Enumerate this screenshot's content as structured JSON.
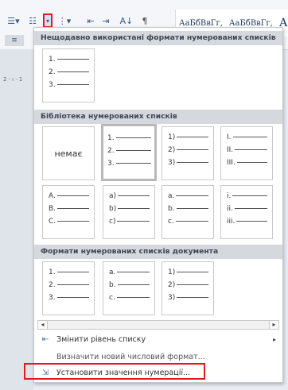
{
  "ribbon": {
    "bullets_icon": "bullet-list-icon",
    "numbering_icon": "numbered-list-icon",
    "multilevel_icon": "multilevel-list-icon",
    "decrease_indent_icon": "decrease-indent-icon",
    "increase_indent_icon": "increase-indent-icon",
    "sort_label": "A↓",
    "pilcrow_label": "¶",
    "styles": [
      "АаБбВвГг,",
      "АаБбВвГг,",
      "А"
    ],
    "ruler_text": "2 · ı · 1"
  },
  "gallery": {
    "recent": {
      "title": "Нещодавно використані формати нумерованих списків",
      "tiles": [
        [
          "1.",
          "2.",
          "3."
        ]
      ]
    },
    "library": {
      "title": "Бібліотека нумерованих списків",
      "none_label": "немає",
      "tiles": [
        [
          "1.",
          "2.",
          "3."
        ],
        [
          "1)",
          "2)",
          "3)"
        ],
        [
          "I.",
          "II.",
          "III."
        ],
        [
          "A.",
          "B.",
          "C."
        ],
        [
          "a)",
          "b)",
          "c)"
        ],
        [
          "a.",
          "b.",
          "c."
        ],
        [
          "i.",
          "ii.",
          "iii."
        ]
      ]
    },
    "document": {
      "title": "Формати нумерованих списків документа",
      "tiles": [
        [
          "1.",
          "2.",
          "3."
        ],
        [
          "a.",
          "b.",
          "c."
        ],
        [
          "1)",
          "2)",
          "3)"
        ]
      ]
    }
  },
  "menu": {
    "change_level": "Змінити рівень списку",
    "define_new": "Визначити новий числовий формат...",
    "set_value": "Установити значення нумерації..."
  },
  "colors": {
    "highlight": "#e3191b",
    "header_bg": "#d5d9de",
    "accent": "#3b6fb0"
  }
}
